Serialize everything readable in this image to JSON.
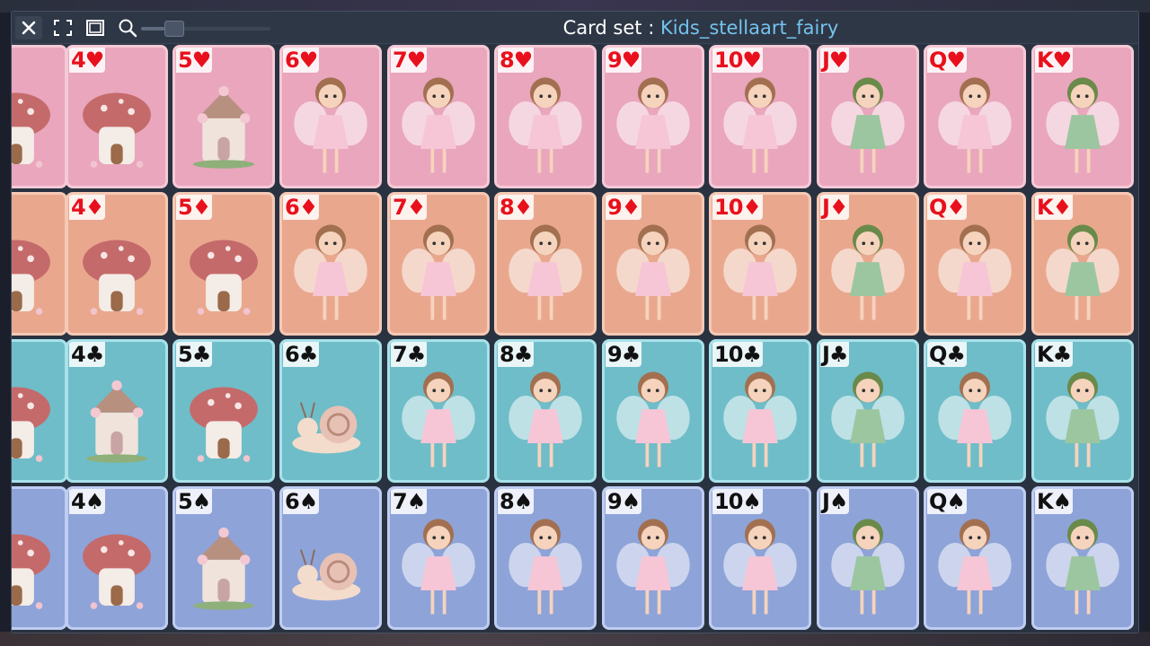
{
  "window": {
    "title_prefix": "Card set : ",
    "set_name": "Kids_stellaart_fairy"
  },
  "toolbar": {
    "close_icon": "close-icon",
    "fullscreen_icon": "fullscreen-icon",
    "window_mode_icon": "window-icon",
    "zoom_icon": "magnifier-icon",
    "zoom_level": 0.18
  },
  "colors": {
    "title_text": "#ffffff",
    "set_name_text": "#74c3ee",
    "red_suit": "#e8101c",
    "black_suit": "#111111"
  },
  "rows": [
    {
      "suit": "hearts",
      "symbol": "♥",
      "suit_color": "#e8101c",
      "bg": "#e9a6bd",
      "border": "#f5c9d6",
      "cards": [
        {
          "rank": "",
          "art": "mushroom-house"
        },
        {
          "rank": "4♥",
          "art": "mushroom-house"
        },
        {
          "rank": "5♥",
          "art": "flower-house"
        },
        {
          "rank": "6♥",
          "art": "fairy"
        },
        {
          "rank": "7♥",
          "art": "fairy"
        },
        {
          "rank": "8♥",
          "art": "fairy"
        },
        {
          "rank": "9♥",
          "art": "fairy"
        },
        {
          "rank": "10♥",
          "art": "fairy"
        },
        {
          "rank": "J♥",
          "art": "fairy-boy"
        },
        {
          "rank": "Q♥",
          "art": "fairy"
        },
        {
          "rank": "K♥",
          "art": "fairy-boy"
        }
      ]
    },
    {
      "suit": "diamonds",
      "symbol": "♦",
      "suit_color": "#e8101c",
      "bg": "#e9a88e",
      "border": "#f5c9b5",
      "cards": [
        {
          "rank": "",
          "art": "mushroom-house"
        },
        {
          "rank": "4♦",
          "art": "mushroom-house"
        },
        {
          "rank": "5♦",
          "art": "mushroom-house"
        },
        {
          "rank": "6♦",
          "art": "fairy"
        },
        {
          "rank": "7♦",
          "art": "fairy"
        },
        {
          "rank": "8♦",
          "art": "fairy"
        },
        {
          "rank": "9♦",
          "art": "fairy"
        },
        {
          "rank": "10♦",
          "art": "fairy"
        },
        {
          "rank": "J♦",
          "art": "fairy-boy"
        },
        {
          "rank": "Q♦",
          "art": "fairy"
        },
        {
          "rank": "K♦",
          "art": "fairy-boy"
        }
      ]
    },
    {
      "suit": "clubs",
      "symbol": "♣",
      "suit_color": "#111111",
      "bg": "#6fbdc8",
      "border": "#a8e2ea",
      "cards": [
        {
          "rank": "",
          "art": "mushroom-house"
        },
        {
          "rank": "4♣",
          "art": "flower-house"
        },
        {
          "rank": "5♣",
          "art": "mushroom-house"
        },
        {
          "rank": "6♣",
          "art": "snail"
        },
        {
          "rank": "7♣",
          "art": "fairy"
        },
        {
          "rank": "8♣",
          "art": "fairy"
        },
        {
          "rank": "9♣",
          "art": "fairy"
        },
        {
          "rank": "10♣",
          "art": "fairy"
        },
        {
          "rank": "J♣",
          "art": "fairy-boy"
        },
        {
          "rank": "Q♣",
          "art": "fairy"
        },
        {
          "rank": "K♣",
          "art": "fairy-boy"
        }
      ]
    },
    {
      "suit": "spades",
      "symbol": "♠",
      "suit_color": "#111111",
      "bg": "#8ea3d8",
      "border": "#bfcdf2",
      "cards": [
        {
          "rank": "",
          "art": "mushroom-house"
        },
        {
          "rank": "4♠",
          "art": "mushroom-house"
        },
        {
          "rank": "5♠",
          "art": "flower-house"
        },
        {
          "rank": "6♠",
          "art": "snail"
        },
        {
          "rank": "7♠",
          "art": "fairy"
        },
        {
          "rank": "8♠",
          "art": "fairy"
        },
        {
          "rank": "9♠",
          "art": "fairy"
        },
        {
          "rank": "10♠",
          "art": "fairy"
        },
        {
          "rank": "J♠",
          "art": "fairy-boy"
        },
        {
          "rank": "Q♠",
          "art": "fairy"
        },
        {
          "rank": "K♠",
          "art": "fairy-boy"
        }
      ]
    }
  ]
}
